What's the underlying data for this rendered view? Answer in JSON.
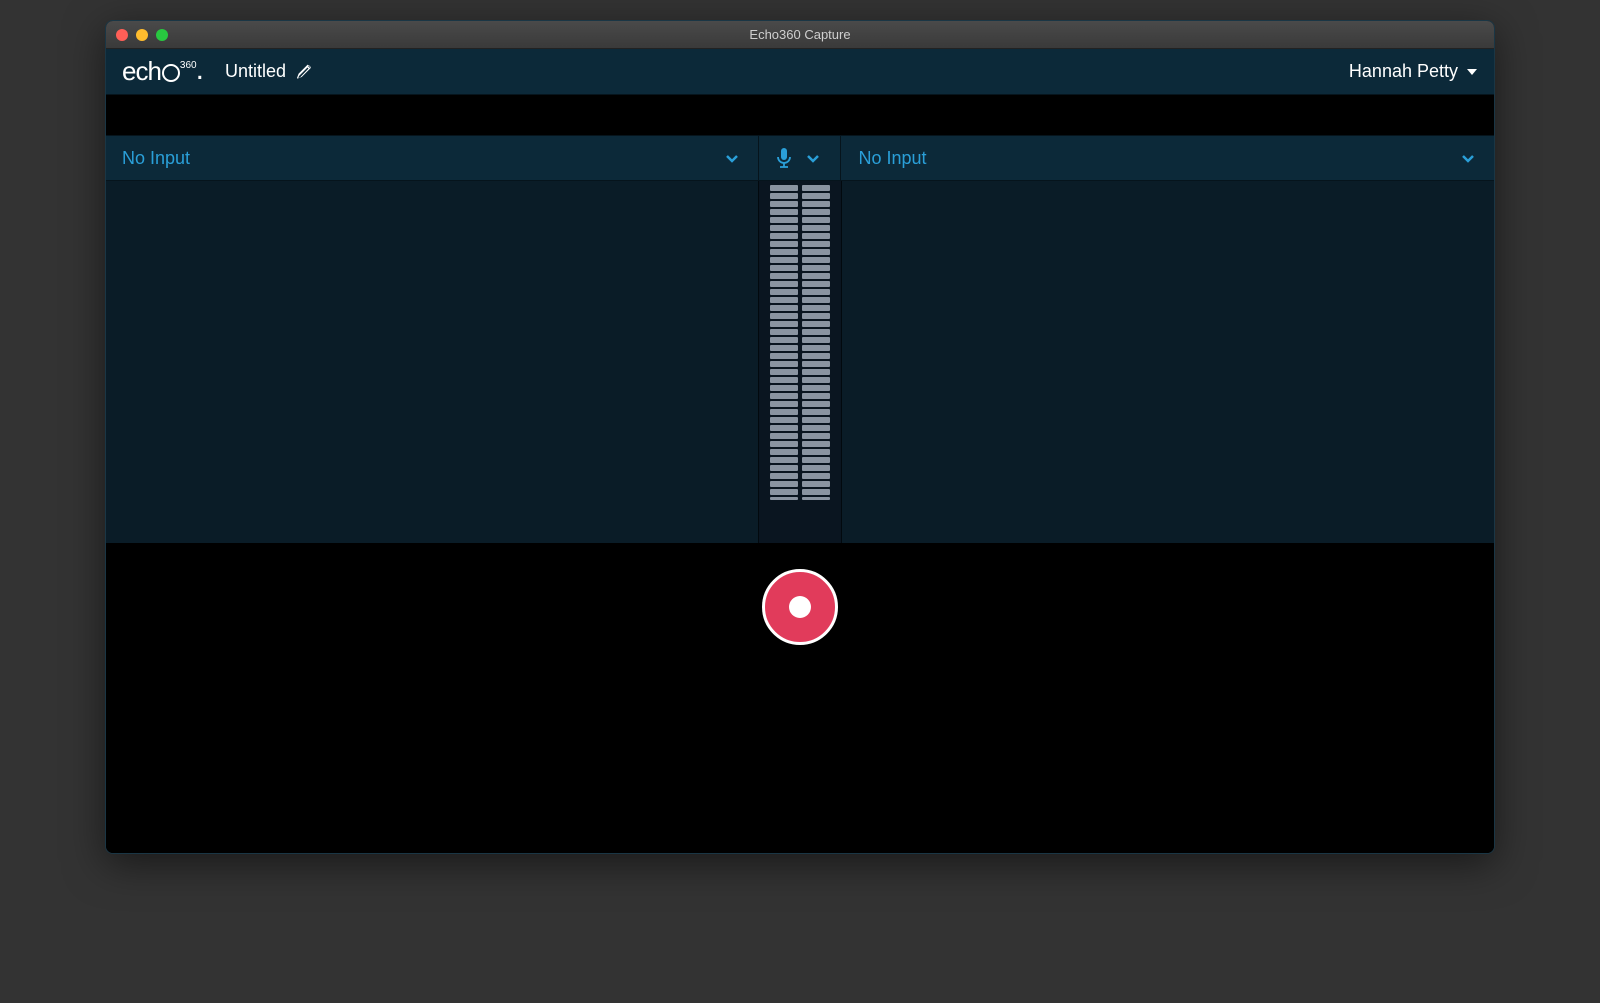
{
  "window": {
    "title": "Echo360 Capture"
  },
  "header": {
    "logo_text": "echo",
    "logo_suffix": "360",
    "doc_title": "Untitled",
    "user_name": "Hannah Petty"
  },
  "sources": {
    "left_label": "No Input",
    "right_label": "No Input"
  },
  "icons": {
    "edit": "pencil-icon",
    "mic": "microphone-icon",
    "dropdown": "chevron-down-icon",
    "user_dropdown": "triangle-down-icon"
  },
  "colors": {
    "accent": "#2a9fd8",
    "header_bg": "#0c2939",
    "panel_bg": "#0a1c27",
    "record": "#e13b5b"
  },
  "audio_meter": {
    "segments": 40
  }
}
